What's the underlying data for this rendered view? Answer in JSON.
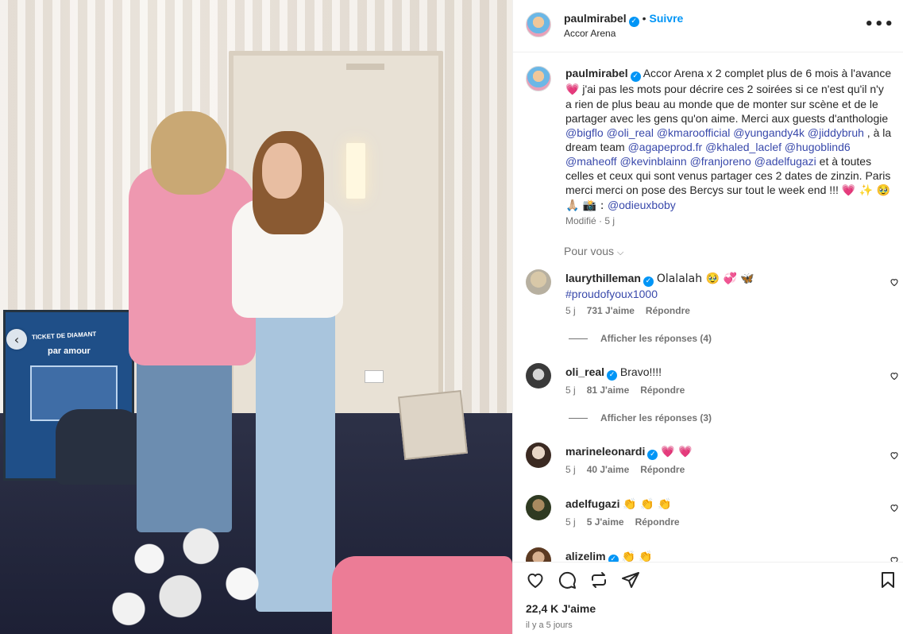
{
  "post_header": {
    "username": "paulmirabel",
    "follow_label": "Suivre",
    "location": "Accor Arena",
    "more_label": "•••"
  },
  "caption": {
    "username": "paulmirabel",
    "text_1": "Accor Arena x 2 complet plus de 6 mois à l'avance ",
    "emoji_1": "💗",
    "text_2": " j'ai pas les mots pour décrire ces 2 soirées si ce n'est qu'il n'y a rien de plus beau au monde que de monter sur scène et de le partager avec les gens qu'on aime. Merci aux guests d'anthologie ",
    "mentions_guests": [
      "@bigflo",
      "@oli_real",
      "@kmaroofficial",
      "@yungandy4k",
      "@jiddybruh"
    ],
    "text_3": " , à la dream team ",
    "mentions_team": [
      "@agapeprod.fr",
      "@khaled_laclef",
      "@hugoblind6",
      "@maheoff",
      "@kevinblainn",
      "@franjoreno",
      "@adelfugazi"
    ],
    "text_4": " et à toutes celles et ceux qui sont venus partager ces 2 dates de zinzin. Paris merci merci on pose des Bercys sur tout le week end !!! ",
    "emoji_end": "💗 ✨ 🥹 🙏🏼 📸 : ",
    "mention_photo": "@odieuxboby",
    "meta": "Modifié · 5 j"
  },
  "for_you_label": "Pour vous",
  "comments": [
    {
      "username": "laurythilleman",
      "verified": true,
      "text": "Olalalah 🥹 💞 🦋",
      "hashtag": "#proudofyoux1000",
      "age": "5 j",
      "likes": "731 J'aime",
      "reply_label": "Répondre",
      "replies_label": "Afficher les réponses (4)"
    },
    {
      "username": "oli_real",
      "verified": true,
      "text": "Bravo!!!!",
      "age": "5 j",
      "likes": "81 J'aime",
      "reply_label": "Répondre",
      "replies_label": "Afficher les réponses (3)"
    },
    {
      "username": "marineleonardi",
      "verified": true,
      "text": "💗 💗",
      "age": "5 j",
      "likes": "40 J'aime",
      "reply_label": "Répondre"
    },
    {
      "username": "adelfugazi",
      "verified": false,
      "text": "👏 👏 👏",
      "age": "5 j",
      "likes": "5 J'aime",
      "reply_label": "Répondre"
    },
    {
      "username": "alizelim",
      "verified": true,
      "text": "👏 👏"
    }
  ],
  "actions": {
    "likes_count": "22,4 K J'aime",
    "posted_ago": "il y a 5 jours"
  },
  "photo": {
    "poster_line1": "TICKET DE DIAMANT",
    "poster_line2": "par amour"
  },
  "colors": {
    "link": "#3949ab",
    "follow": "#0095f6",
    "verified": "#0095f6",
    "muted": "#737373"
  }
}
